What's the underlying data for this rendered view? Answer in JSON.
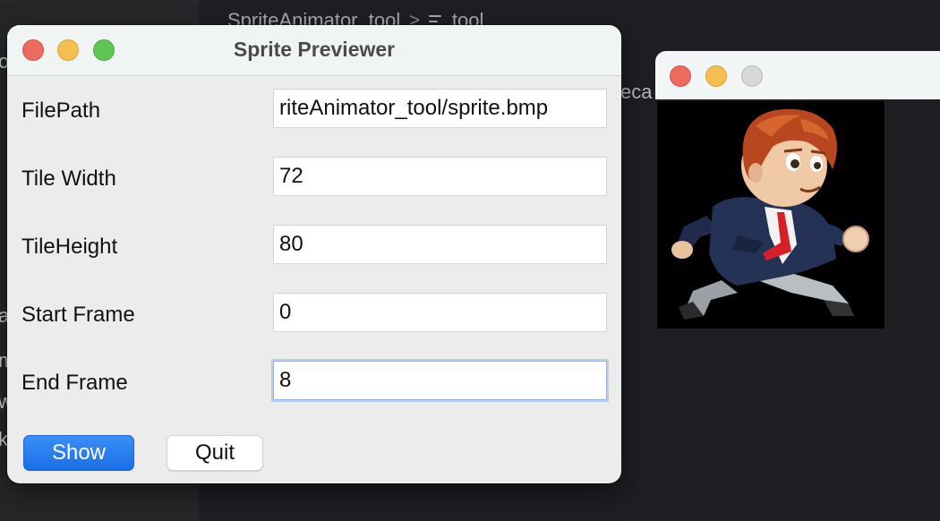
{
  "background": {
    "breadcrumb": {
      "project": "SpriteAnimator_tool",
      "separator": ">",
      "file": "tool"
    },
    "side_chars": [
      "o",
      "a",
      "m",
      "w",
      "k"
    ],
    "editor_partial_text": "eca"
  },
  "dialog": {
    "title": "Sprite Previewer",
    "fields": [
      {
        "label": "FilePath",
        "value": "riteAnimator_tool/sprite.bmp"
      },
      {
        "label": "Tile Width",
        "value": "72"
      },
      {
        "label": "TileHeight",
        "value": "80"
      },
      {
        "label": "Start Frame",
        "value": "0"
      },
      {
        "label": "End Frame",
        "value": "8"
      }
    ],
    "buttons": {
      "show": "Show",
      "quit": "Quit"
    },
    "colors": {
      "accent": "#1b6fe6",
      "close": "#ec6a5e",
      "minimize": "#f4bf4f",
      "zoom": "#61c554"
    }
  },
  "preview": {
    "sprite_icon": "running-boy-sprite-icon"
  }
}
